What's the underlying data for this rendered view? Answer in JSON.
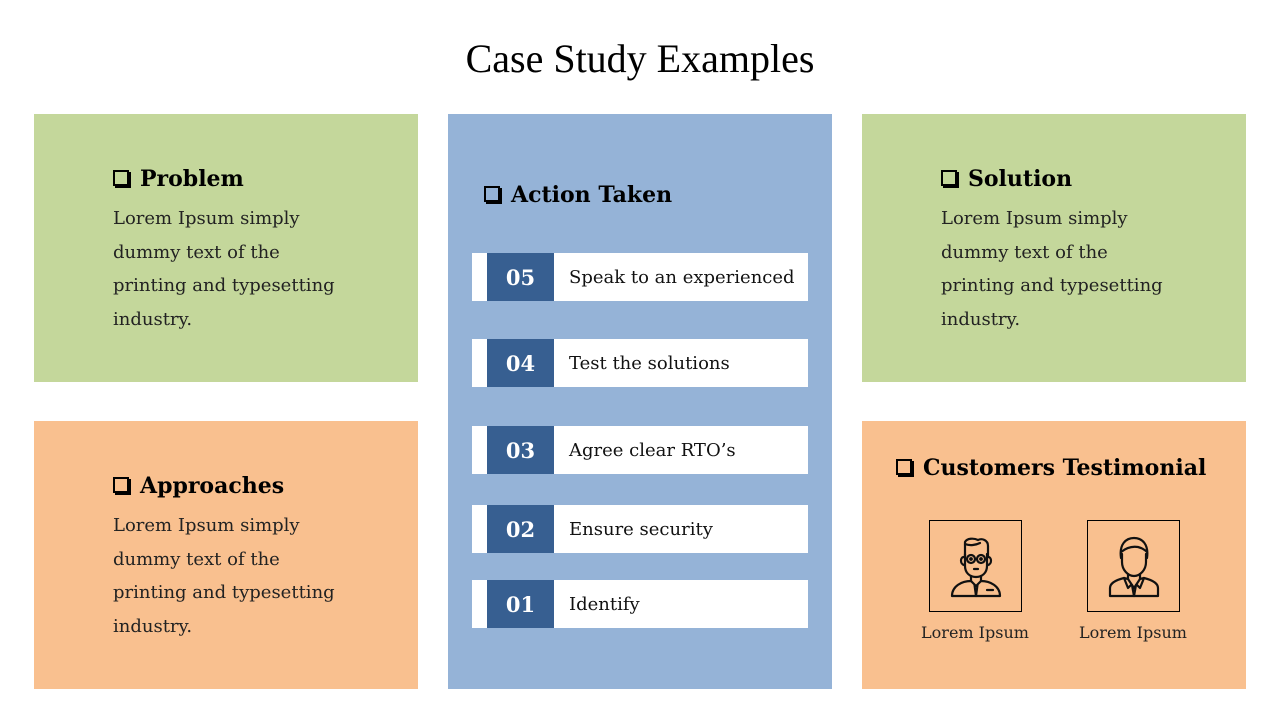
{
  "title": "Case Study Examples",
  "colors": {
    "green": "#c4d79b",
    "orange": "#f9c08f",
    "blue": "#95b3d7",
    "step_number_bg": "#375f91"
  },
  "problem": {
    "heading": "Problem",
    "bullet_icon": "checkbox-square-icon",
    "text": "Lorem Ipsum simply dummy text of the printing and typesetting industry."
  },
  "approaches": {
    "heading": "Approaches",
    "bullet_icon": "checkbox-square-icon",
    "text": "Lorem Ipsum simply dummy text of the printing and typesetting industry."
  },
  "solution": {
    "heading": "Solution",
    "bullet_icon": "checkbox-square-icon",
    "text": "Lorem Ipsum simply dummy text of the printing and typesetting industry."
  },
  "action_taken": {
    "heading": "Action Taken",
    "bullet_icon": "checkbox-square-icon",
    "steps": [
      {
        "number": "05",
        "label": "Speak to an experienced"
      },
      {
        "number": "04",
        "label": "Test the solutions"
      },
      {
        "number": "03",
        "label": "Agree clear RTO’s"
      },
      {
        "number": "02",
        "label": "Ensure security"
      },
      {
        "number": "01",
        "label": "Identify"
      }
    ]
  },
  "testimonial": {
    "heading": "Customers Testimonial",
    "bullet_icon": "checkbox-square-icon",
    "people": [
      {
        "icon": "businessman-glasses-icon",
        "label": "Lorem Ipsum"
      },
      {
        "icon": "businessman-suit-icon",
        "label": "Lorem Ipsum"
      }
    ]
  }
}
